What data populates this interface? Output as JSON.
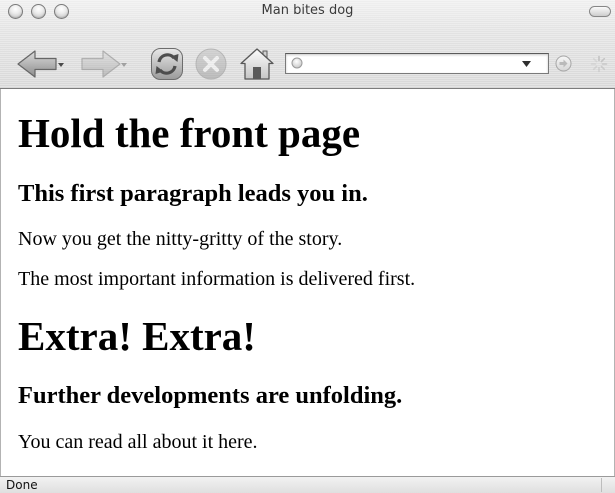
{
  "window": {
    "title": "Man bites dog"
  },
  "toolbar": {
    "back": {
      "icon": "back-arrow-icon",
      "enabled": true
    },
    "forward": {
      "icon": "forward-arrow-icon",
      "enabled": false
    },
    "reload": {
      "icon": "reload-icon",
      "enabled": true
    },
    "stop": {
      "icon": "stop-icon",
      "enabled": false
    },
    "home": {
      "icon": "home-icon",
      "enabled": true
    },
    "address_bar": {
      "value": "",
      "icon": "page-proxy-icon",
      "dropdown_icon": "chevron-down-icon"
    },
    "go": {
      "icon": "go-arrow-icon"
    },
    "throbber": {
      "icon": "throbber-icon"
    }
  },
  "page": {
    "heading_1": "Hold the front page",
    "subheading_1": "This first paragraph leads you in.",
    "paragraph_1": "Now you get the nitty-gritty of the story.",
    "paragraph_2": "The most important information is delivered first.",
    "heading_2": "Extra! Extra!",
    "subheading_2": "Further developments are unfolding.",
    "paragraph_3": "You can read all about it here."
  },
  "status_bar": {
    "text": "Done"
  },
  "colors": {
    "page_background": "#ffffff",
    "page_text": "#000000",
    "chrome_background": "#e3e3e3"
  }
}
